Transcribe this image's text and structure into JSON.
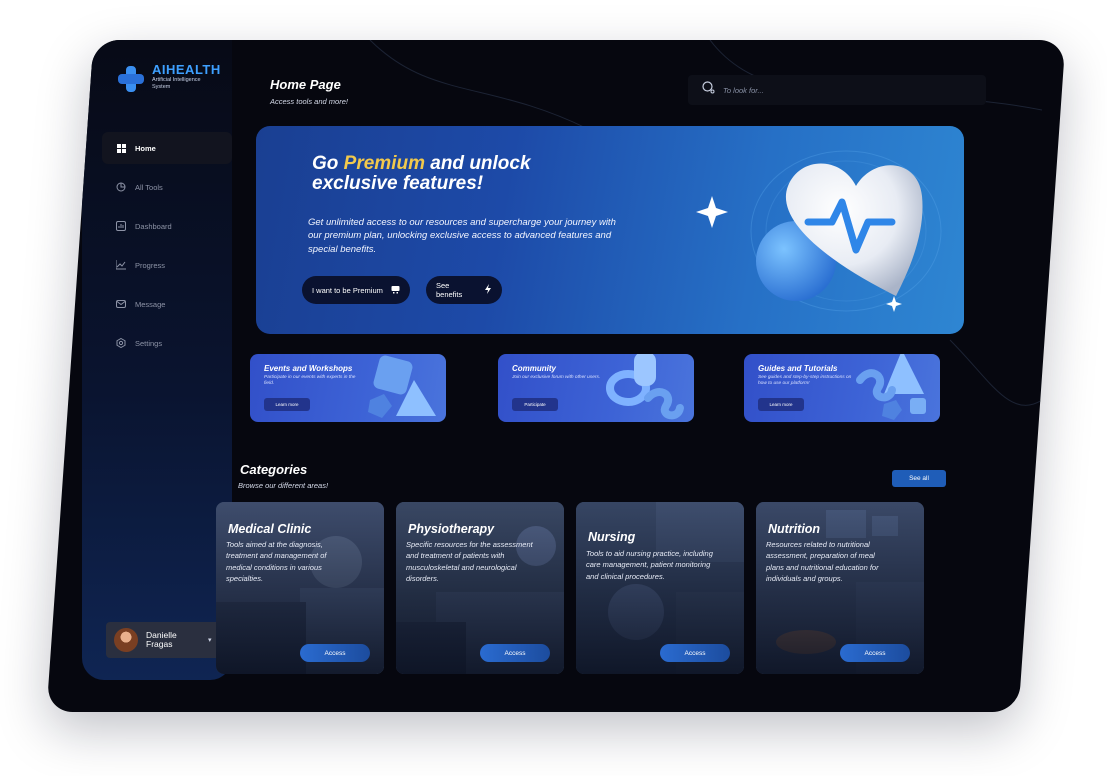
{
  "brand": {
    "title": "AIHEALTH",
    "subtitle": "Artificial Intelligence System"
  },
  "sidebar": {
    "items": [
      {
        "label": "Home",
        "icon": "grid-icon",
        "active": true
      },
      {
        "label": "All Tools",
        "icon": "chart-pie-icon",
        "active": false
      },
      {
        "label": "Dashboard",
        "icon": "bar-chart-icon",
        "active": false
      },
      {
        "label": "Progress",
        "icon": "line-chart-icon",
        "active": false
      },
      {
        "label": "Message",
        "icon": "mail-icon",
        "active": false
      },
      {
        "label": "Settings",
        "icon": "gear-icon",
        "active": false
      }
    ]
  },
  "profile": {
    "name": "Danielle Fragas"
  },
  "header": {
    "title": "Home Page",
    "subtitle": "Access tools and more!"
  },
  "search": {
    "placeholder": "To look for..."
  },
  "hero": {
    "title_pre": "Go ",
    "title_highlight": "Premium",
    "title_post": " and unlock",
    "title_line2": "exclusive features!",
    "description": "Get unlimited access to our resources and supercharge your journey with our premium plan, unlocking exclusive access to advanced features and special benefits.",
    "primary_button": "I want to be Premium",
    "secondary_button": "See benefits"
  },
  "features": [
    {
      "title": "Events and Workshops",
      "description": "Participate in our events with experts in the field.",
      "button": "Learn more"
    },
    {
      "title": "Community",
      "description": "Join our exclusive forum with other users.",
      "button": "Participate"
    },
    {
      "title": "Guides and Tutorials",
      "description": "See guides and step-by-step instructions on how to use our platform!",
      "button": "Learn more"
    }
  ],
  "categories": {
    "title": "Categories",
    "subtitle": "Browse our different areas!",
    "see_all": "See all",
    "items": [
      {
        "name": "Medical Clinic",
        "description": "Tools aimed at the diagnosis, treatment and management of medical conditions in various specialties.",
        "button": "Access"
      },
      {
        "name": "Physiotherapy",
        "description": "Specific resources for the assessment and treatment of patients with musculoskeletal and neurological disorders.",
        "button": "Access"
      },
      {
        "name": "Nursing",
        "description": "Tools to aid nursing practice, including care management, patient monitoring and clinical procedures.",
        "button": "Access"
      },
      {
        "name": "Nutrition",
        "description": "Resources related to nutritional assessment, preparation of meal plans and nutritional education for individuals and groups.",
        "button": "Access"
      }
    ]
  },
  "colors": {
    "accent": "#3ea0ff",
    "highlight": "#f2c94c",
    "background": "#06070f"
  }
}
